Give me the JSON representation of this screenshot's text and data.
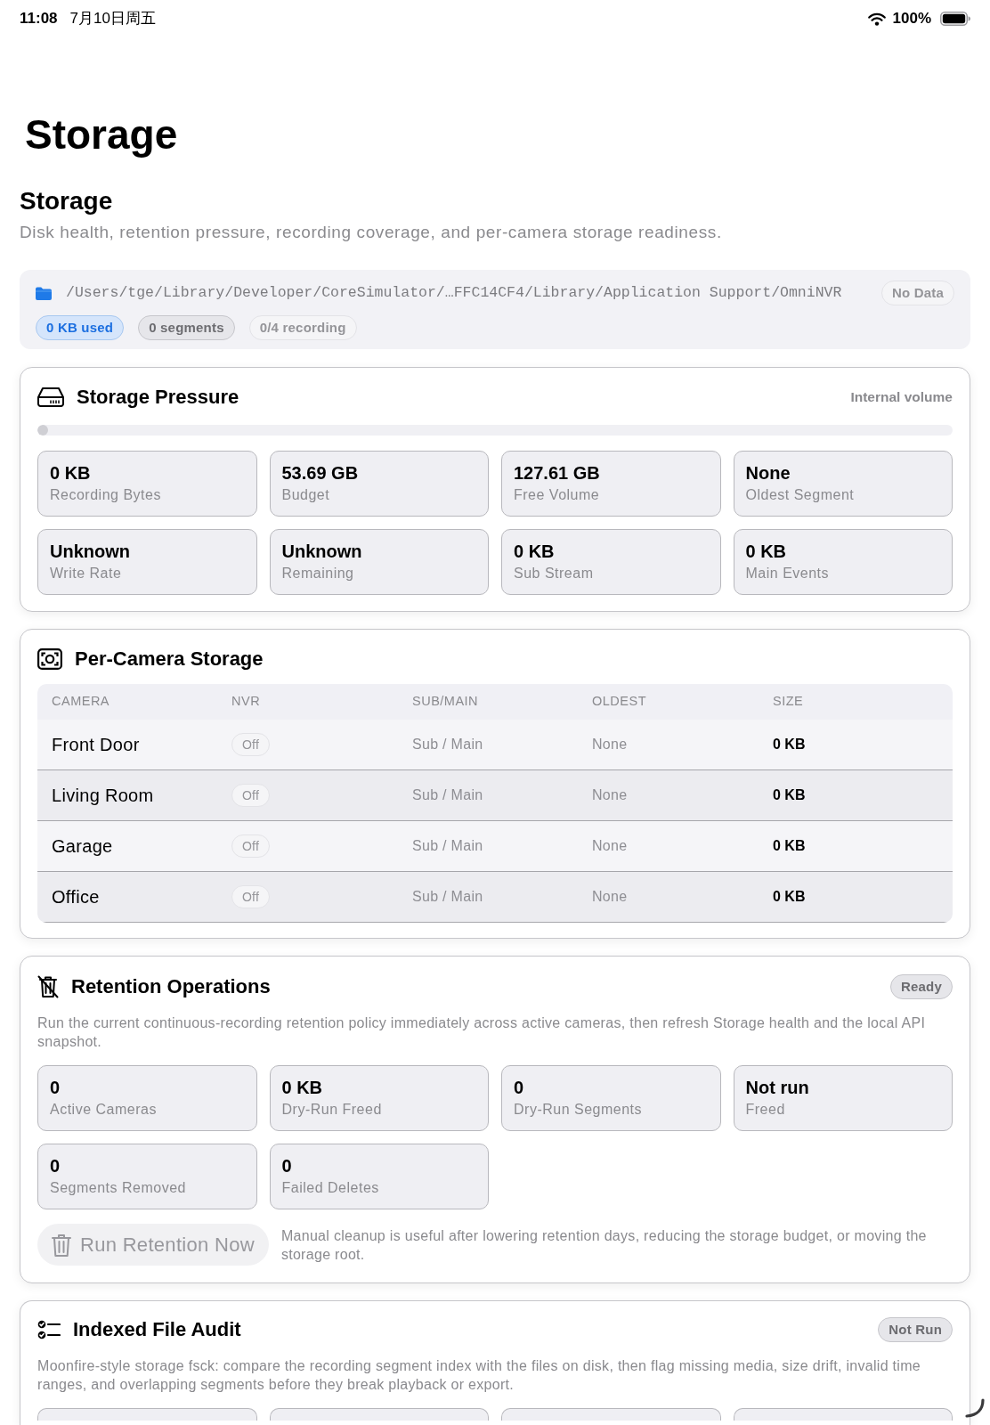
{
  "status_bar": {
    "time": "11:08",
    "date": "7月10日周五",
    "battery": "100%"
  },
  "page_title": "Storage",
  "section": {
    "title": "Storage",
    "subtitle": "Disk health, retention pressure, recording coverage, and per-camera storage readiness."
  },
  "storage_root": {
    "path": "/Users/tge/Library/Developer/CoreSimulator/…FFC14CF4/Library/Application Support/OmniNVR",
    "status": {
      "label": "No Data",
      "kind": "faded"
    },
    "chips": [
      {
        "label": "0 KB used",
        "kind": "accent"
      },
      {
        "label": "0 segments",
        "kind": "neutral"
      },
      {
        "label": "0/4 recording",
        "kind": "faded"
      }
    ]
  },
  "storage_pressure": {
    "title": "Storage Pressure",
    "volume": "Internal volume",
    "usage": {
      "level": 0
    },
    "metrics": [
      {
        "value": "0 KB",
        "label": "Recording Bytes"
      },
      {
        "value": "53.69 GB",
        "label": "Budget"
      },
      {
        "value": "127.61 GB",
        "label": "Free Volume"
      },
      {
        "value": "None",
        "label": "Oldest Segment"
      },
      {
        "value": "Unknown",
        "label": "Write Rate"
      },
      {
        "value": "Unknown",
        "label": "Remaining"
      },
      {
        "value": "0 KB",
        "label": "Sub Stream"
      },
      {
        "value": "0 KB",
        "label": "Main Events"
      }
    ]
  },
  "per_camera": {
    "title": "Per-Camera Storage",
    "table": {
      "columns": [
        "CAMERA",
        "NVR",
        "SUB/MAIN",
        "OLDEST",
        "SIZE"
      ],
      "rows": [
        {
          "camera": "Front Door",
          "nvr": {
            "label": "Off",
            "on": false
          },
          "streams": "Sub / Main",
          "oldest": "None",
          "size": "0 KB"
        },
        {
          "camera": "Living Room",
          "nvr": {
            "label": "Off",
            "on": false
          },
          "streams": "Sub / Main",
          "oldest": "None",
          "size": "0 KB"
        },
        {
          "camera": "Garage",
          "nvr": {
            "label": "Off",
            "on": false
          },
          "streams": "Sub / Main",
          "oldest": "None",
          "size": "0 KB"
        },
        {
          "camera": "Office",
          "nvr": {
            "label": "Off",
            "on": false
          },
          "streams": "Sub / Main",
          "oldest": "None",
          "size": "0 KB"
        }
      ]
    }
  },
  "retention": {
    "title": "Retention Operations",
    "status": {
      "label": "Ready",
      "kind": "neutral"
    },
    "description": "Run the current continuous-recording retention policy immediately across active cameras, then refresh Storage health and the local API snapshot.",
    "metrics": [
      {
        "value": "0",
        "label": "Active Cameras"
      },
      {
        "value": "0 KB",
        "label": "Dry-Run Freed"
      },
      {
        "value": "0",
        "label": "Dry-Run Segments"
      },
      {
        "value": "Not run",
        "label": "Freed"
      },
      {
        "value": "0",
        "label": "Segments Removed"
      },
      {
        "value": "0",
        "label": "Failed Deletes"
      }
    ],
    "action": {
      "label": "Run Retention Now",
      "disabled": true
    },
    "note": "Manual cleanup is useful after lowering retention days, reducing the storage budget, or moving the storage root."
  },
  "audit": {
    "title": "Indexed File Audit",
    "status": {
      "label": "Not Run",
      "kind": "neutral"
    },
    "description": "Moonfire-style storage fsck: compare the recording segment index with the files on disk, then flag missing media, size drift, invalid time ranges, and overlapping segments before they break playback or export.",
    "metrics": [
      {
        "cut_off": true
      },
      {
        "cut_off": true
      },
      {
        "cut_off": true
      },
      {
        "cut_off": true
      }
    ]
  }
}
